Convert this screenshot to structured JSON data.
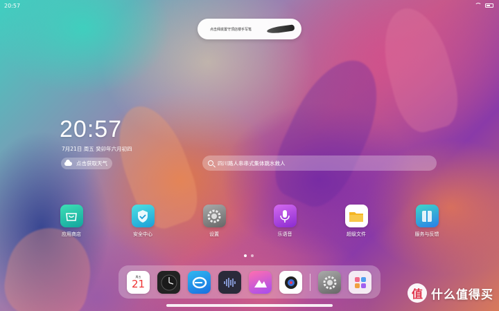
{
  "status_bar": {
    "time": "20:57",
    "icons": [
      "wifi-icon",
      "battery-icon"
    ]
  },
  "pen_banner": {
    "text": "点击拜底置守顶店楼手写笔"
  },
  "clock_widget": {
    "time": "20:57",
    "date": "7月21日 周五 癸卯年六月初四",
    "weather": "点击获取天气"
  },
  "search": {
    "placeholder": "四川路人串串式集体跳水救人"
  },
  "apps": [
    {
      "label": "应用商店",
      "icon": "app-store-icon",
      "color": "#22c3a6"
    },
    {
      "label": "安全中心",
      "icon": "security-shield-icon",
      "color": "#1fb5d8"
    },
    {
      "label": "设置",
      "icon": "settings-gear-icon",
      "color": "#8a8a8a"
    },
    {
      "label": "乐语音",
      "icon": "microphone-icon",
      "color": "#b33bdc"
    },
    {
      "label": "超级文件",
      "icon": "folder-icon",
      "color": "#f5b623"
    },
    {
      "label": "服务与反馈",
      "icon": "service-feedback-icon",
      "color": "#2f9ee8"
    }
  ],
  "dock": {
    "calendar": {
      "weekday": "周五",
      "day": "21"
    },
    "items": [
      "calendar-icon",
      "clock-icon",
      "browser-icon",
      "voice-recorder-icon",
      "gallery-icon",
      "camera-icon",
      "settings-gear-icon",
      "app-folder-icon"
    ]
  },
  "pages": {
    "count": 2,
    "active": 0
  },
  "watermark": {
    "logo": "值",
    "text": "什么值得买"
  }
}
